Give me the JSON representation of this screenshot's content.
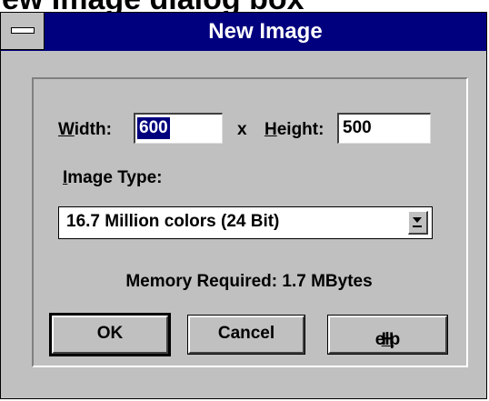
{
  "background": {
    "title_text": "ew Image dialog box"
  },
  "window": {
    "title": "New Image"
  },
  "form": {
    "width_label": "Width:",
    "width_accel": "W",
    "width_rest": "idth:",
    "width_value": "600",
    "times": "x",
    "height_accel": "H",
    "height_rest": "eight:",
    "height_value": "500",
    "image_type_accel": "I",
    "image_type_rest": "mage Type:",
    "image_type_value": "16.7 Million colors (24 Bit)",
    "memory_text": "Memory Required: 1.7 MBytes"
  },
  "buttons": {
    "ok": "OK",
    "cancel": "Cancel",
    "help_accel": "H",
    "help_rest": "elp"
  },
  "colors": {
    "titlebar": "#00007f",
    "face": "#c0c0c0",
    "selection": "#00007f"
  }
}
